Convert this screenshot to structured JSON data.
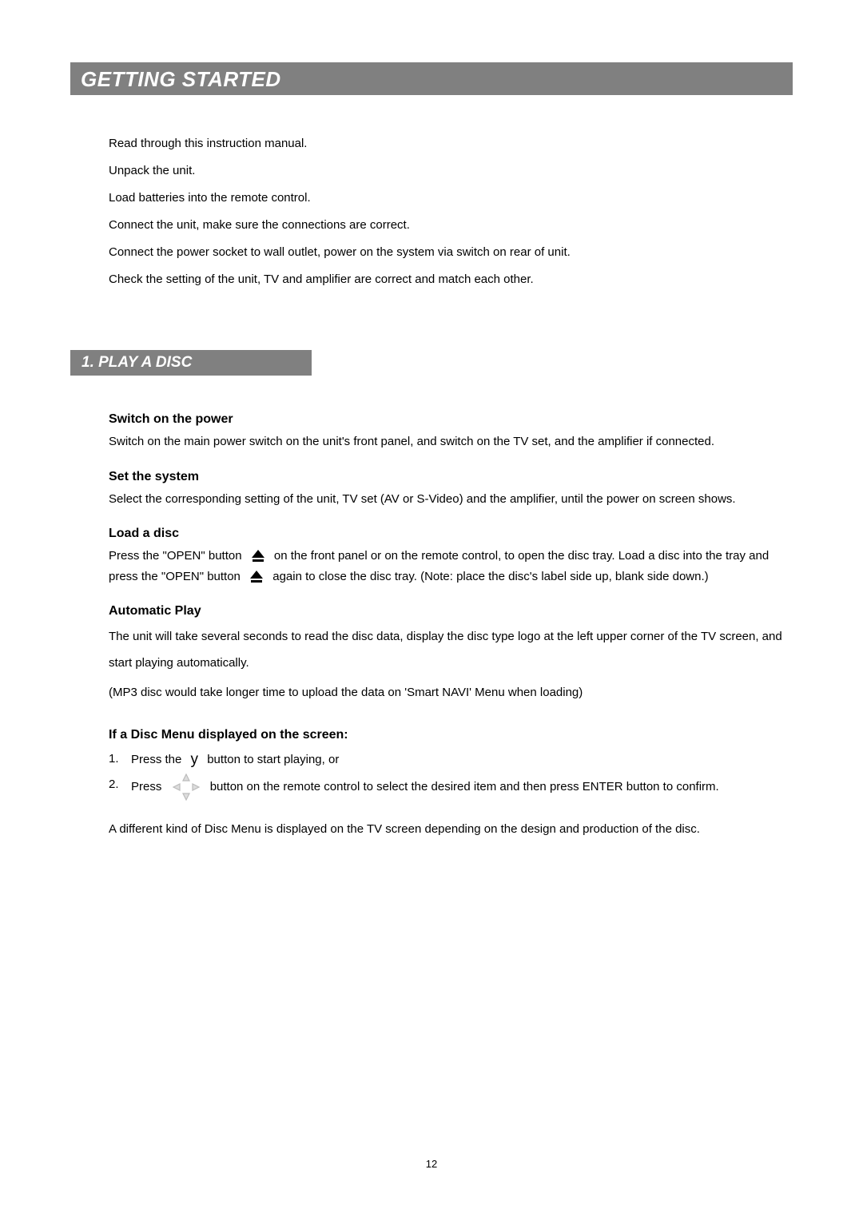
{
  "header": {
    "title": "GETTING STARTED"
  },
  "intro": {
    "items": [
      "Read through this instruction manual.",
      "Unpack the unit.",
      "Load batteries into the remote control.",
      "Connect the unit, make sure the connections are correct.",
      "Connect the power socket to wall outlet, power on the system via switch on rear of unit.",
      "Check the setting of the unit, TV and amplifier are correct and match each other."
    ]
  },
  "section1": {
    "title": "1. PLAY A DISC",
    "switch_on": {
      "heading": "Switch on the power",
      "body": "Switch on the main power switch on the unit's front panel, and switch on the TV set, and the amplifier if connected."
    },
    "set_system": {
      "heading": "Set the system",
      "body": "Select the corresponding setting of the unit, TV set (AV or S-Video) and the amplifier, until the power on screen shows."
    },
    "load_disc": {
      "heading": "Load a disc",
      "pre1": "Press the \"OPEN\" button",
      "post1": "on the front panel or on the remote control, to open the disc tray. Load a disc into the tray and press the \"OPEN\" button",
      "post2": "again to close the disc tray. (Note: place the disc's label side up, blank side down.)"
    },
    "auto_play": {
      "heading": "Automatic Play",
      "body1": "The unit will take several seconds to read the disc data, display the disc type logo at the left upper corner of the TV screen, and start playing automatically.",
      "body2": "(MP3 disc would take longer time to upload the data on 'Smart NAVI' Menu when loading)"
    },
    "disc_menu": {
      "heading": "If a Disc Menu displayed on the screen:",
      "item1_num": "1.",
      "item1_pre": "Press the",
      "item1_post": "button to start playing, or",
      "item2_num": "2.",
      "item2_pre": "Press",
      "item2_post": "button on the remote control to select the desired item and then press ENTER  button  to confirm."
    },
    "note": "A different kind of Disc Menu is displayed on the TV screen depending on the design and production of the disc."
  },
  "page_number": "12"
}
